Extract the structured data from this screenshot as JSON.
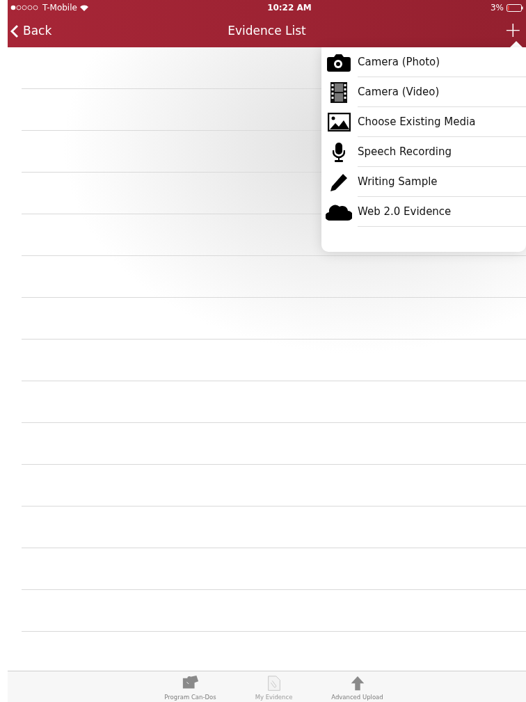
{
  "status_bar": {
    "carrier": "T-Mobile",
    "time": "10:22 AM",
    "battery": "3%"
  },
  "nav": {
    "back": "Back",
    "title": "Evidence List",
    "add": "+"
  },
  "menu": {
    "items": [
      {
        "kind": "camera",
        "label": "Camera (Photo)"
      },
      {
        "kind": "film",
        "label": "Camera (Video)"
      },
      {
        "kind": "image",
        "label": "Choose Existing Media"
      },
      {
        "kind": "mic",
        "label": "Speech Recording"
      },
      {
        "kind": "pencil",
        "label": "Writing Sample"
      },
      {
        "kind": "cloud",
        "label": "Web 2.0 Evidence"
      }
    ]
  },
  "tab_bar": {
    "items": [
      {
        "kind": "puzzle",
        "label": "Program Can-Dos",
        "selected": false
      },
      {
        "kind": "paperclip",
        "label": "My Evidence",
        "selected": true
      },
      {
        "kind": "upload",
        "label": "Advanced Upload",
        "selected": false
      }
    ]
  }
}
